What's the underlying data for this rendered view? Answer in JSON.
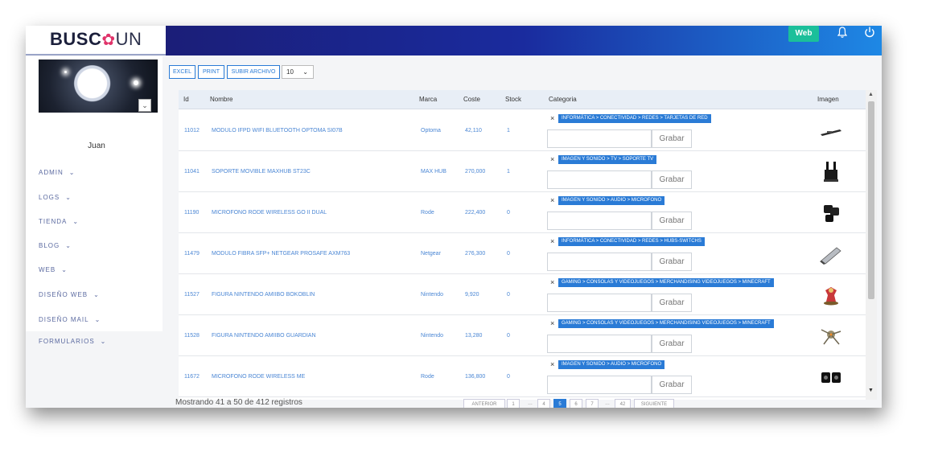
{
  "brand": {
    "logo_left": "BUSC",
    "logo_flower": "✿",
    "logo_right": "UN"
  },
  "sidebar": {
    "username": "Juan",
    "items": [
      {
        "label": "ADMIN"
      },
      {
        "label": "LOGS"
      },
      {
        "label": "TIENDA"
      },
      {
        "label": "BLOG"
      },
      {
        "label": "WEB"
      },
      {
        "label": "DISEÑO WEB"
      },
      {
        "label": "DISEÑO MAIL"
      },
      {
        "label": "FORMULARIOS"
      }
    ]
  },
  "topbar": {
    "web_label": "Web",
    "icons": [
      "bell-icon",
      "power-icon"
    ]
  },
  "toolbar": {
    "excel": "EXCEL",
    "print": "PRINT",
    "upload": "SUBIR ARCHIVO",
    "page_length": "10"
  },
  "table": {
    "headers": [
      "Id",
      "Nombre",
      "Marca",
      "Coste",
      "Stock",
      "Categoria",
      "Imagen"
    ],
    "save_label": "Grabar",
    "remove_glyph": "×",
    "rows": [
      {
        "id": "11012",
        "name": "MODULO IFPD WIFI BLUETOOTH OPTOMA SI07B",
        "brand": "Optoma",
        "cost": "42,110",
        "stock": "1",
        "category": "INFORMÁTICA > CONECTIVIDAD > REDES > TARJETAS DE RED",
        "image": "wifi-module"
      },
      {
        "id": "11041",
        "name": "SOPORTE MOVIBLE MAXHUB ST23C",
        "brand": "MAX HUB",
        "cost": "270,000",
        "stock": "1",
        "category": "IMAGEN Y SONIDO > TV > SOPORTE TV",
        "image": "tv-stand"
      },
      {
        "id": "11190",
        "name": "MICROFONO RODE WIRELESS GO II DUAL",
        "brand": "Rode",
        "cost": "222,400",
        "stock": "0",
        "category": "IMAGEN Y SONIDO > AUDIO > MICROFONO",
        "image": "wireless-mic"
      },
      {
        "id": "11479",
        "name": "MODULO FIBRA SFP+ NETGEAR PROSAFE AXM763",
        "brand": "Netgear",
        "cost": "276,300",
        "stock": "0",
        "category": "INFORMÁTICA > CONECTIVIDAD > REDES > HUBS-SWITCHS",
        "image": "sfp-module"
      },
      {
        "id": "11527",
        "name": "FIGURA NINTENDO AMIIBO BOKOBLIN",
        "brand": "Nintendo",
        "cost": "9,920",
        "stock": "0",
        "category": "GAMING > CONSOLAS Y VIDEOJUEGOS > MERCHANDISING VIDEOJUEGOS > MINECRAFT",
        "image": "figure-red"
      },
      {
        "id": "11528",
        "name": "FIGURA NINTENDO AMIIBO GUARDIAN",
        "brand": "Nintendo",
        "cost": "13,280",
        "stock": "0",
        "category": "GAMING > CONSOLAS Y VIDEOJUEGOS > MERCHANDISING VIDEOJUEGOS > MINECRAFT",
        "image": "figure-guardian"
      },
      {
        "id": "11672",
        "name": "MICROFONO RODE WIRELESS ME",
        "brand": "Rode",
        "cost": "136,800",
        "stock": "0",
        "category": "IMAGEN Y SONIDO > AUDIO > MICROFONO",
        "image": "mic-pair"
      }
    ]
  },
  "footer": {
    "info": "Mostrando 41 a 50 de 412 registros",
    "pages": [
      "ANTERIOR",
      "1",
      "…",
      "4",
      "5",
      "6",
      "7",
      "…",
      "42",
      "SIGUIENTE"
    ],
    "active_page": "5"
  },
  "colors": {
    "accent": "#2a7bd6",
    "web_button": "#1bbf9a",
    "topbar_start": "#1b1e78",
    "topbar_end": "#1e88e5"
  }
}
